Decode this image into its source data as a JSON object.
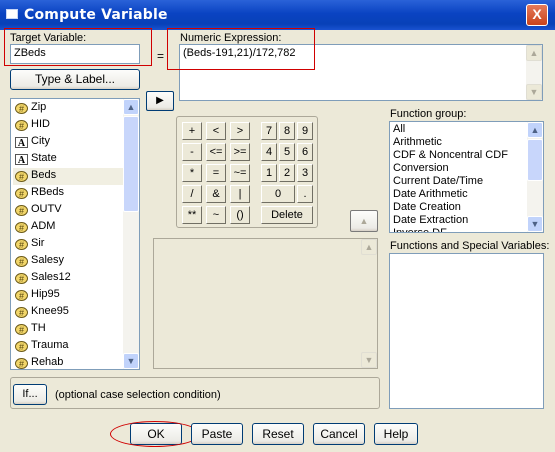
{
  "window": {
    "title": "Compute Variable",
    "close_glyph": "X"
  },
  "target": {
    "label": "Target Variable:",
    "value": "ZBeds"
  },
  "equals": "=",
  "expression": {
    "label": "Numeric Expression:",
    "value": "(Beds-191,21)/172,782"
  },
  "type_label_button": "Type & Label...",
  "move_button": "▶",
  "variables": [
    {
      "name": "Zip",
      "icon": "scale-icon"
    },
    {
      "name": "HID",
      "icon": "scale-icon"
    },
    {
      "name": "City",
      "icon": "nominal-icon"
    },
    {
      "name": "State",
      "icon": "nominal-icon"
    },
    {
      "name": "Beds",
      "icon": "scale-icon",
      "selected": true
    },
    {
      "name": "RBeds",
      "icon": "scale-icon"
    },
    {
      "name": "OUTV",
      "icon": "scale-icon"
    },
    {
      "name": "ADM",
      "icon": "scale-icon"
    },
    {
      "name": "Sir",
      "icon": "scale-icon"
    },
    {
      "name": "Salesy",
      "icon": "scale-icon"
    },
    {
      "name": "Sales12",
      "icon": "scale-icon"
    },
    {
      "name": "Hip95",
      "icon": "scale-icon"
    },
    {
      "name": "Knee95",
      "icon": "scale-icon"
    },
    {
      "name": "TH",
      "icon": "scale-icon"
    },
    {
      "name": "Trauma",
      "icon": "scale-icon"
    },
    {
      "name": "Rehab",
      "icon": "scale-icon"
    }
  ],
  "keypad": {
    "ops": [
      [
        "+",
        "<",
        ">"
      ],
      [
        "-",
        "<=",
        ">="
      ],
      [
        "*",
        "=",
        "~="
      ],
      [
        "/",
        "&",
        "|"
      ],
      [
        "**",
        "~",
        "()"
      ]
    ],
    "digits": [
      [
        "7",
        "8",
        "9"
      ],
      [
        "4",
        "5",
        "6"
      ],
      [
        "1",
        "2",
        "3"
      ]
    ],
    "zero": "0",
    "dot": ".",
    "delete": "Delete"
  },
  "function_group": {
    "label": "Function group:",
    "items": [
      "All",
      "Arithmetic",
      "CDF & Noncentral CDF",
      "Conversion",
      "Current Date/Time",
      "Date Arithmetic",
      "Date Creation",
      "Date Extraction",
      "Inverse DF"
    ]
  },
  "functions_label": "Functions and Special Variables:",
  "up_arrow": "▲",
  "if_button": "If...",
  "if_text": "(optional case selection condition)",
  "buttons": {
    "ok": "OK",
    "paste": "Paste",
    "reset": "Reset",
    "cancel": "Cancel",
    "help": "Help"
  }
}
